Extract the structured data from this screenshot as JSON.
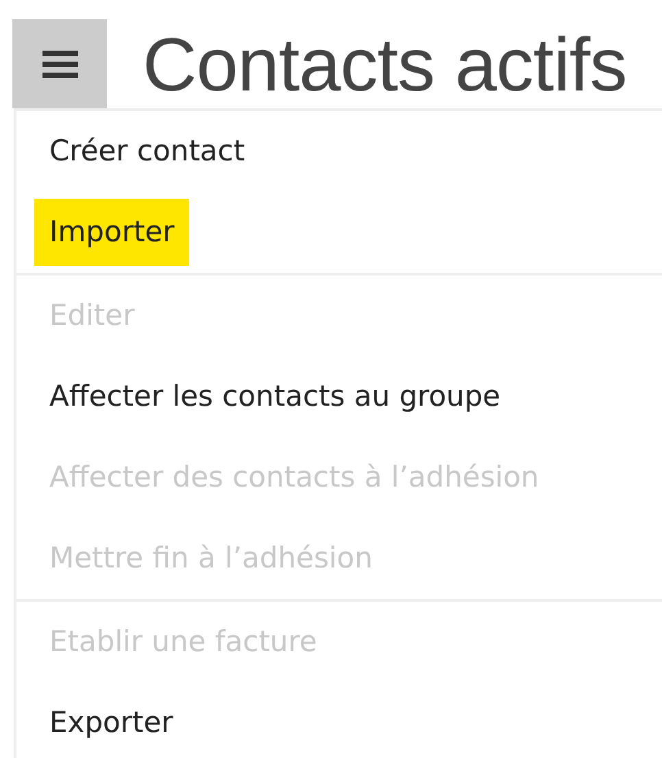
{
  "header": {
    "title": "Contacts actifs"
  },
  "menu": {
    "groups": [
      {
        "items": [
          {
            "label": "Créer contact",
            "disabled": false,
            "highlighted": false
          },
          {
            "label": "Importer",
            "disabled": false,
            "highlighted": true
          }
        ]
      },
      {
        "items": [
          {
            "label": "Editer",
            "disabled": true,
            "highlighted": false
          },
          {
            "label": "Affecter les contacts au groupe",
            "disabled": false,
            "highlighted": false
          },
          {
            "label": "Affecter des contacts à l’adhésion",
            "disabled": true,
            "highlighted": false
          },
          {
            "label": "Mettre fin à l’adhésion",
            "disabled": true,
            "highlighted": false
          }
        ]
      },
      {
        "items": [
          {
            "label": "Etablir une facture",
            "disabled": true,
            "highlighted": false
          },
          {
            "label": "Exporter",
            "disabled": false,
            "highlighted": false
          }
        ]
      }
    ]
  }
}
